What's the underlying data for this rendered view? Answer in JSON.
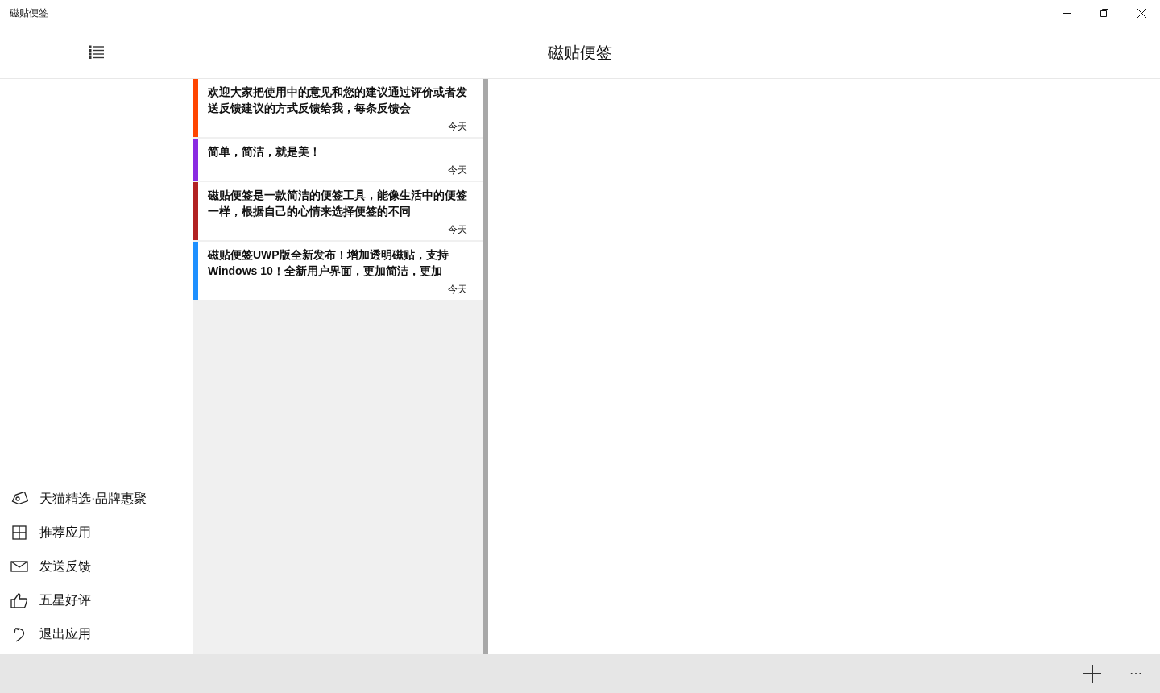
{
  "window": {
    "title": "磁贴便签"
  },
  "header": {
    "title": "磁贴便签"
  },
  "notes": [
    {
      "text": "欢迎大家把使用中的意见和您的建议通过评价或者发送反馈建议的方式反馈给我，每条反馈会",
      "date": "今天",
      "color": "#ff4500"
    },
    {
      "text": "简单，简洁，就是美！",
      "date": "今天",
      "color": "#8a2be2"
    },
    {
      "text": "磁贴便签是一款简洁的便签工具，能像生活中的便签一样，根据自己的心情来选择便签的不同",
      "date": "今天",
      "color": "#b22222"
    },
    {
      "text": "磁贴便签UWP版全新发布！增加透明磁贴，支持Windows 10！全新用户界面，更加简洁，更加",
      "date": "今天",
      "color": "#1e90ff"
    }
  ],
  "sidebar": {
    "items": [
      {
        "kind": "tag",
        "label": "天猫精选·品牌惠聚"
      },
      {
        "kind": "apps",
        "label": "推荐应用"
      },
      {
        "kind": "mail",
        "label": "发送反馈"
      },
      {
        "kind": "like",
        "label": "五星好评"
      },
      {
        "kind": "exit",
        "label": "退出应用"
      }
    ]
  },
  "bottom_bar": {
    "more": "⋯"
  }
}
